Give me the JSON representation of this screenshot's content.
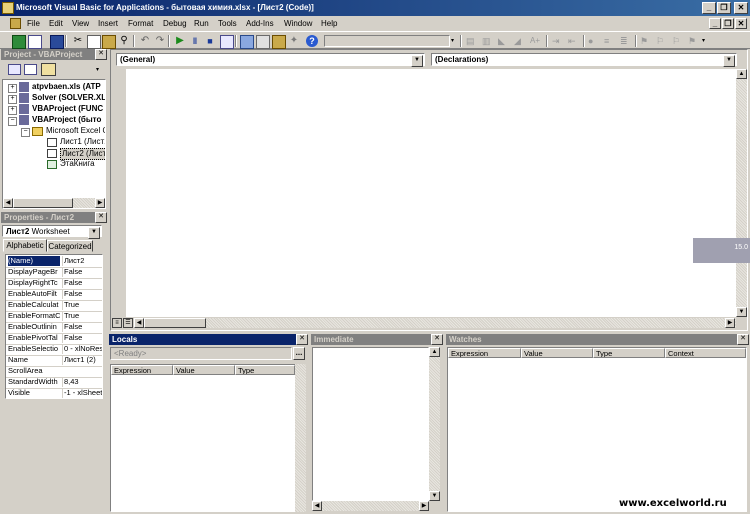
{
  "window": {
    "title": "Microsoft Visual Basic for Applications - бытовая химия.xlsx - [Лист2 (Code)]",
    "minimize": "_",
    "restore": "❐",
    "close": "✕"
  },
  "menubar": {
    "items": [
      "File",
      "Edit",
      "View",
      "Insert",
      "Format",
      "Debug",
      "Run",
      "Tools",
      "Add-Ins",
      "Window",
      "Help"
    ],
    "doc_controls": [
      "_",
      "❐",
      "✕"
    ]
  },
  "project": {
    "title": "Project - VBAProject",
    "tree": [
      {
        "label": "atpvbaen.xls (ATP",
        "bold": true
      },
      {
        "label": "Solver (SOLVER.XL",
        "bold": true
      },
      {
        "label": "VBAProject (FUNC",
        "bold": true
      },
      {
        "label": "VBAProject (быто",
        "bold": true
      },
      {
        "label": "Microsoft Excel O",
        "bold": false
      },
      {
        "label": "Лист1 (Лист1",
        "bold": false
      },
      {
        "label": "Лист2 (Лист1",
        "bold": false
      },
      {
        "label": "ЭтаКнига",
        "bold": false
      }
    ]
  },
  "properties": {
    "title": "Properties - Лист2",
    "object_name": "Лист2",
    "object_type": "Worksheet",
    "tabs": [
      "Alphabetic",
      "Categorized"
    ],
    "rows": [
      {
        "name": "(Name)",
        "value": "Лист2"
      },
      {
        "name": "DisplayPageBr",
        "value": "False"
      },
      {
        "name": "DisplayRightTc",
        "value": "False"
      },
      {
        "name": "EnableAutoFilt",
        "value": "False"
      },
      {
        "name": "EnableCalculat",
        "value": "True"
      },
      {
        "name": "EnableFormatC",
        "value": "True"
      },
      {
        "name": "EnableOutlinin",
        "value": "False"
      },
      {
        "name": "EnablePivotTal",
        "value": "False"
      },
      {
        "name": "EnableSelectio",
        "value": "0 - xlNoRestr"
      },
      {
        "name": "Name",
        "value": "Лист1 (2)"
      },
      {
        "name": "ScrollArea",
        "value": ""
      },
      {
        "name": "StandardWidth",
        "value": "8,43"
      },
      {
        "name": "Visible",
        "value": "-1 - xlSheetV"
      }
    ]
  },
  "code": {
    "object_combo": "(General)",
    "proc_combo": "(Declarations)",
    "tooltip": "15.0"
  },
  "locals": {
    "title": "Locals",
    "status": "<Ready>",
    "ellipsis": "...",
    "columns": [
      "Expression",
      "Value",
      "Type"
    ]
  },
  "immediate": {
    "title": "Immediate"
  },
  "watches": {
    "title": "Watches",
    "columns": [
      "Expression",
      "Value",
      "Type",
      "Context"
    ]
  },
  "watermark": "www.excelworld.ru",
  "colors": {
    "active_title": "#0a246a",
    "inactive_title": "#808080",
    "face": "#d4d0c8"
  }
}
